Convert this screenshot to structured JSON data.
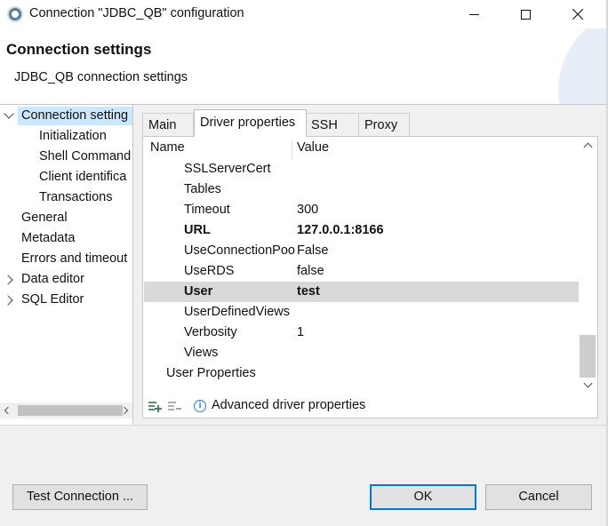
{
  "window": {
    "title": "Connection \"JDBC_QB\" configuration"
  },
  "banner": {
    "title": "Connection settings",
    "subtitle": "JDBC_QB connection settings"
  },
  "nav": {
    "items": [
      {
        "label": "Connection setting",
        "level": 0,
        "expanded": true,
        "selected": true
      },
      {
        "label": "Initialization",
        "level": 1
      },
      {
        "label": "Shell Command",
        "level": 1
      },
      {
        "label": "Client identifica",
        "level": 1
      },
      {
        "label": "Transactions",
        "level": 1
      },
      {
        "label": "General",
        "level": 0
      },
      {
        "label": "Metadata",
        "level": 0
      },
      {
        "label": "Errors and timeout",
        "level": 0
      },
      {
        "label": "Data editor",
        "level": 0,
        "expandable": true
      },
      {
        "label": "SQL Editor",
        "level": 0,
        "expandable": true
      }
    ]
  },
  "tabs": [
    {
      "label": "Main",
      "active": false
    },
    {
      "label": "Driver properties",
      "active": true
    },
    {
      "label": "SSH",
      "active": false
    },
    {
      "label": "Proxy",
      "active": false
    }
  ],
  "table": {
    "columns": [
      "Name",
      "Value"
    ],
    "rows": [
      {
        "name": "SSLServerCert",
        "value": ""
      },
      {
        "name": "Tables",
        "value": ""
      },
      {
        "name": "Timeout",
        "value": "300"
      },
      {
        "name": "URL",
        "value": "127.0.0.1:8166",
        "bold": true
      },
      {
        "name": "UseConnectionPoo",
        "value": "False"
      },
      {
        "name": "UseRDS",
        "value": "false"
      },
      {
        "name": "User",
        "value": "test",
        "bold": true,
        "selected": true
      },
      {
        "name": "UserDefinedViews",
        "value": ""
      },
      {
        "name": "Verbosity",
        "value": "1"
      },
      {
        "name": "Views",
        "value": ""
      },
      {
        "name": "User Properties",
        "value": "",
        "group": true
      }
    ]
  },
  "toolbar": {
    "advanced_label": "Advanced driver properties"
  },
  "buttons": {
    "test_connection": "Test Connection ...",
    "ok": "OK",
    "cancel": "Cancel"
  },
  "colors": {
    "selection": "#cce8ff",
    "row_selected": "#d9d9d9",
    "accent": "#0078d7"
  }
}
